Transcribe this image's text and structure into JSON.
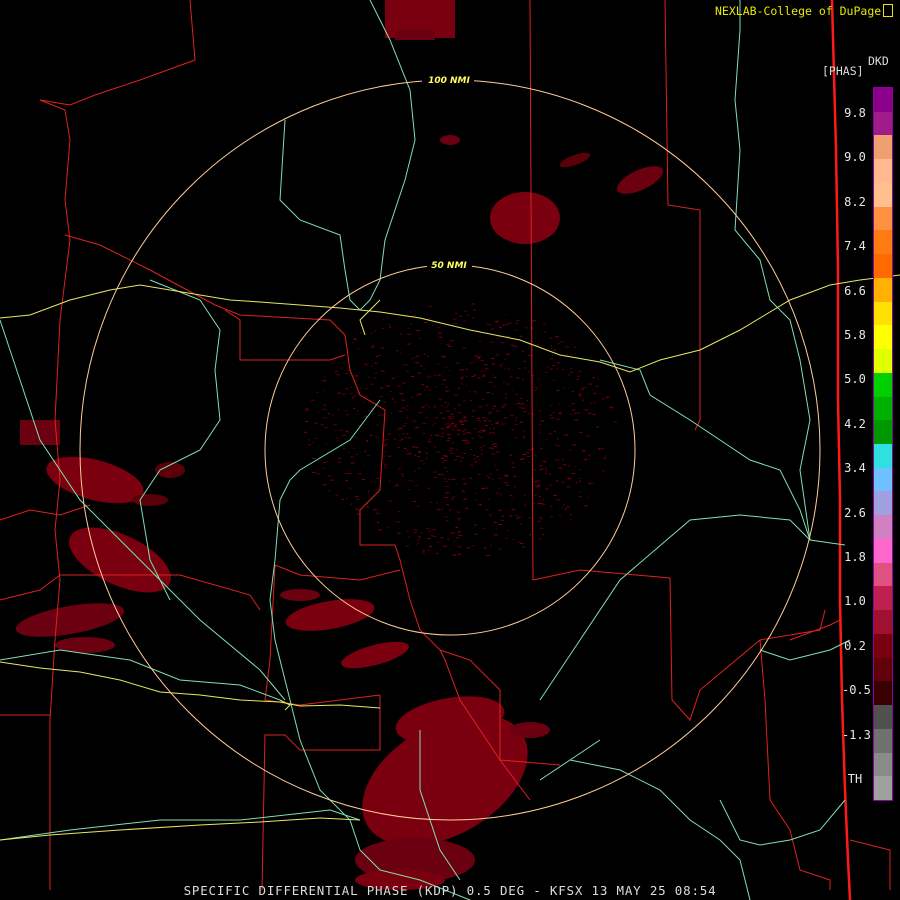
{
  "header": {
    "credit": "NEXLAB-College of DuPage"
  },
  "legend": {
    "product_code": "DKD",
    "units": "[PHAS]",
    "tick_labels": [
      "9.8",
      "9.0",
      "8.2",
      "7.4",
      "6.6",
      "5.8",
      "5.0",
      "4.2",
      "3.4",
      "2.6",
      "1.8",
      "1.0",
      "0.2",
      "-0.5",
      "-1.3",
      "TH"
    ],
    "colors": [
      "#8a008a",
      "#a01c8c",
      "#f0a070",
      "#ffb890",
      "#ffc090",
      "#ff9040",
      "#ff7a10",
      "#ff6a00",
      "#ffb000",
      "#ffe000",
      "#ffff00",
      "#e0ff00",
      "#00d000",
      "#00b000",
      "#009800",
      "#30e0e0",
      "#70c0ff",
      "#a0a0e0",
      "#d080c0",
      "#ff66cc",
      "#e05080",
      "#c02050",
      "#a01030",
      "#7a0010",
      "#600008",
      "#3a0000",
      "#505050",
      "#707070",
      "#8a8a8a",
      "#a0a0a0"
    ]
  },
  "rings": {
    "inner_label": "50 NMI",
    "outer_label": "100 NMI",
    "color": "#ffcc99"
  },
  "colors": {
    "county_lines": "#dd2222",
    "rivers": "#80e0b0",
    "highways": "#e8e860",
    "echo": "#7a0010",
    "echo_dark": "#5a0008"
  },
  "footer": {
    "product": "SPECIFIC DIFFERENTIAL PHASE (KDP)",
    "elevation": "0.5 DEG",
    "site": "KFSX",
    "datetime": "13 MAY 25 08:54"
  }
}
